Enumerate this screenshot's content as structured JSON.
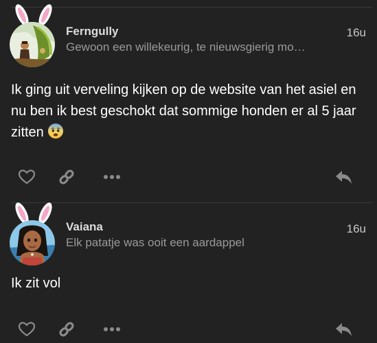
{
  "posts": [
    {
      "username": "Ferngully",
      "user_title": "Gewoon een willekeurig, te nieuwsgierig mo…",
      "time": "16u",
      "body": "Ik ging uit verveling kijken op de website van het asiel en nu ben ik best geschokt dat sommige honden er al 5 jaar zitten",
      "emoji": "anxious-face-icon",
      "avatar": "avatar-ferngully"
    },
    {
      "username": "Vaiana",
      "user_title": "Elk patatje was ooit een aardappel",
      "time": "16u",
      "body": "Ik zit vol",
      "avatar": "avatar-vaiana"
    }
  ],
  "actions": [
    "heart-icon",
    "link-icon",
    "more-icon",
    "reply-icon"
  ],
  "colors": {
    "background": "#222222",
    "text": "#ffffff",
    "muted": "#9a9a9a",
    "icon": "#8a8a8a",
    "divider": "#3a3a3a"
  }
}
